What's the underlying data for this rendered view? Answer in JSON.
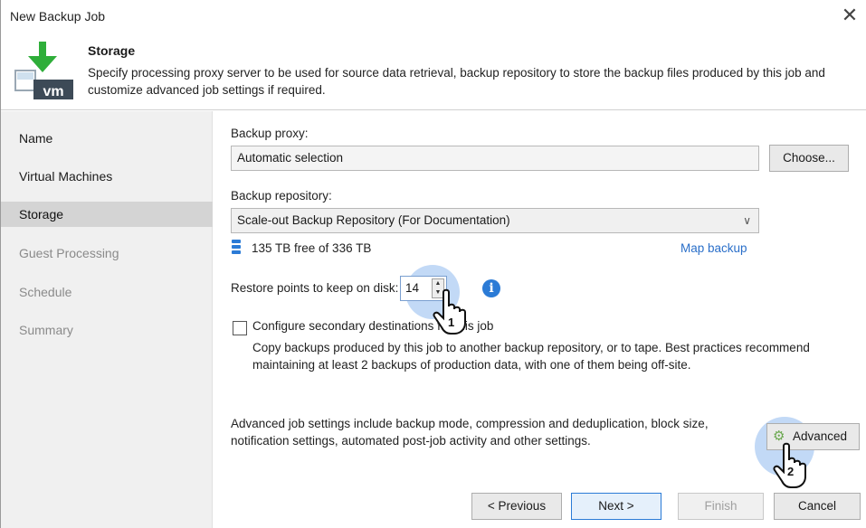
{
  "window": {
    "title": "New Backup Job",
    "close_glyph": "✕"
  },
  "header": {
    "title": "Storage",
    "description": "Specify processing proxy server to be used for source data retrieval, backup repository to store the backup files produced by this job and customize advanced job settings if required.",
    "icon": "vm-backup-icon",
    "icon_text": "vm"
  },
  "sidebar": {
    "items": [
      {
        "label": "Name",
        "state": "normal"
      },
      {
        "label": "Virtual Machines",
        "state": "normal"
      },
      {
        "label": "Storage",
        "state": "active"
      },
      {
        "label": "Guest Processing",
        "state": "disabled"
      },
      {
        "label": "Schedule",
        "state": "disabled"
      },
      {
        "label": "Summary",
        "state": "disabled"
      }
    ]
  },
  "proxy": {
    "label": "Backup proxy:",
    "value": "Automatic selection",
    "choose_label": "Choose..."
  },
  "repository": {
    "label": "Backup repository:",
    "value": "Scale-out Backup Repository (For Documentation)",
    "free_space": "135 TB free of 336 TB",
    "map_backup_label": "Map backup"
  },
  "restore_points": {
    "label": "Restore points to keep on disk:",
    "value": "14",
    "info_glyph": "i"
  },
  "secondary": {
    "label": "Configure secondary destinations for this job",
    "checked": false,
    "description": "Copy backups produced by this job to another backup repository, or to tape. Best practices recommend maintaining at least 2 backups of production data, with one of them being off-site."
  },
  "advanced": {
    "description": "Advanced job settings include backup mode, compression and deduplication, block size, notification settings, automated post-job activity and other settings.",
    "button_label": "Advanced"
  },
  "footer": {
    "previous_label": "< Previous",
    "next_label": "Next >",
    "finish_label": "Finish",
    "cancel_label": "Cancel"
  },
  "annotations": {
    "step1": "1",
    "step2": "2"
  },
  "colors": {
    "accent": "#2b7bd6",
    "link": "#2a6fc9",
    "sidebar_bg": "#f0f0f0",
    "active_item_bg": "#d4d4d4",
    "highlight": "#78aaeb"
  }
}
